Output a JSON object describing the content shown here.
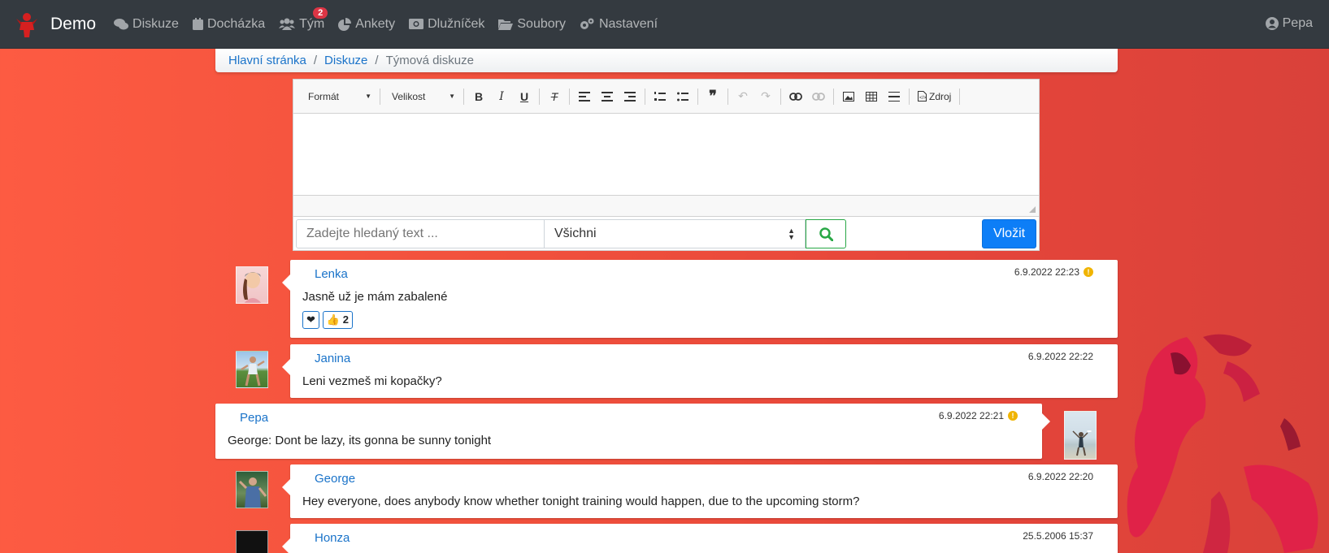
{
  "brand": {
    "name": "Demo",
    "logo": "red-figure-logo"
  },
  "nav": {
    "items": [
      {
        "label": "Diskuze",
        "icon": "comments-icon"
      },
      {
        "label": "Docházka",
        "icon": "calendar-icon"
      },
      {
        "label": "Tým",
        "icon": "users-icon",
        "badge": "2"
      },
      {
        "label": "Ankety",
        "icon": "pie-chart-icon"
      },
      {
        "label": "Dlužníček",
        "icon": "money-icon"
      },
      {
        "label": "Soubory",
        "icon": "folder-open-icon"
      },
      {
        "label": "Nastavení",
        "icon": "cogs-icon"
      }
    ],
    "user": {
      "label": "Pepa",
      "icon": "user-circle-icon"
    }
  },
  "breadcrumb": {
    "home": "Hlavní stránka",
    "section": "Diskuze",
    "current": "Týmová diskuze"
  },
  "editor": {
    "format_label": "Formát",
    "size_label": "Velikost",
    "source_label": "Zdroj",
    "search_placeholder": "Zadejte hledaný text ...",
    "filter_value": "Všichni",
    "submit_label": "Vložit"
  },
  "posts": [
    {
      "author": "Lenka",
      "time": "6.9.2022 22:23",
      "text": "Jasně už je mám zabalené",
      "info": true,
      "reactions": [
        {
          "label": "❤"
        },
        {
          "label": "👍 2"
        }
      ]
    },
    {
      "author": "Janina",
      "time": "6.9.2022 22:22",
      "text": "Leni vezmeš mi kopačky?",
      "info": false
    },
    {
      "author": "Pepa",
      "time": "6.9.2022 22:21",
      "text": "George: Dont be lazy, its gonna be sunny tonight",
      "info": true
    },
    {
      "author": "George",
      "time": "6.9.2022 22:20",
      "text": "Hey everyone, does anybody know whether tonight training would happen, due to the upcoming storm?",
      "info": false
    },
    {
      "author": "Honza",
      "time": "25.5.2006 15:37",
      "text": "",
      "info": false
    }
  ],
  "colors": {
    "navbar": "#343a40",
    "accent": "#0d7ef7",
    "link": "#1a73c9",
    "background": "#f0503c",
    "search_button": "#28a745"
  }
}
